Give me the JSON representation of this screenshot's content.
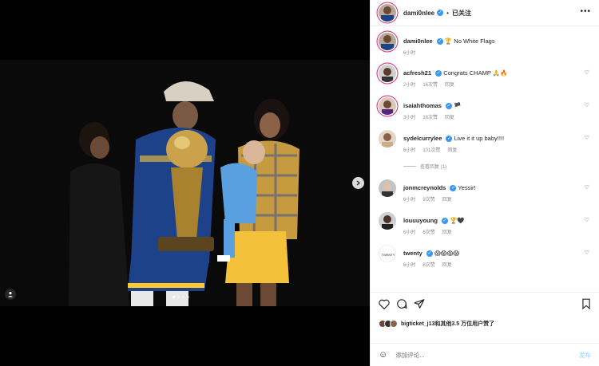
{
  "header": {
    "username": "dami0nlee",
    "separator": "•",
    "follow_status": "已关注",
    "more": "•••"
  },
  "caption": {
    "username": "dami0nlee",
    "text": "🏆 No White Flags",
    "time": "6小时"
  },
  "comments": [
    {
      "username": "acfresh21",
      "verified": true,
      "text": "Congrats CHAMP 🙏🔥",
      "time": "2小时",
      "likes": "16次赞",
      "reply": "回复"
    },
    {
      "username": "isaiahthomas",
      "verified": true,
      "text": "🏴",
      "time": "3小时",
      "likes": "18次赞",
      "reply": "回复"
    },
    {
      "username": "sydelcurrylee",
      "verified": true,
      "text": "Live it it up baby!!!!",
      "time": "6小时",
      "likes": "101次赞",
      "reply": "回复"
    },
    {
      "username": "jonmcreynolds",
      "verified": true,
      "text": "Yessir!",
      "time": "6小时",
      "likes": "9次赞",
      "reply": "回复"
    },
    {
      "username": "louuuyoung",
      "verified": true,
      "text": "🏆🖤",
      "time": "6小时",
      "likes": "6次赞",
      "reply": "回复"
    },
    {
      "username": "twenty",
      "verified": true,
      "text": "😱😱😱😱",
      "time": "6小时",
      "likes": "8次赞",
      "reply": "回复"
    }
  ],
  "view_replies": "查看回复 (1)",
  "likes_text": "bigticket_j13和其他3.5 万位用户赞了",
  "composer": {
    "placeholder": "添加评论...",
    "post_label": "发布"
  },
  "colors": {
    "verified": "#3897f0",
    "story_ring": "#d62976",
    "post_button": "#b2dffc"
  }
}
